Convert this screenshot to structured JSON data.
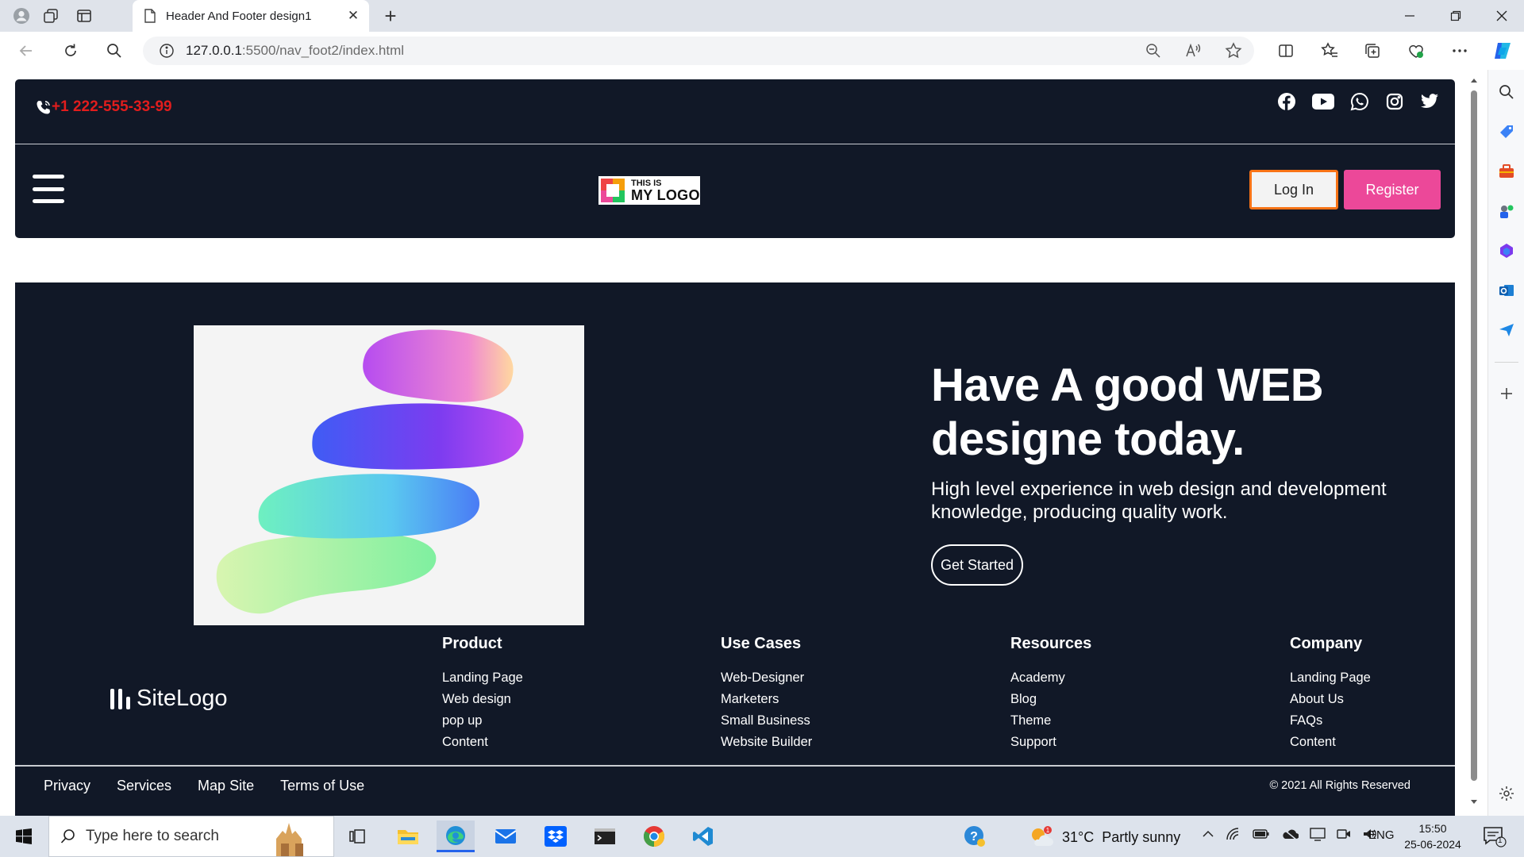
{
  "browser": {
    "tab_title": "Header And Footer design1",
    "url_host": "127.0.0.1",
    "url_path": ":5500/nav_foot2/index.html"
  },
  "header": {
    "phone": "+1 222-555-33-99",
    "logo_line1": "THIS IS",
    "logo_line2": "MY LOGO",
    "login_label": "Log In",
    "register_label": "Register",
    "social_icons": [
      "facebook-icon",
      "youtube-icon",
      "whatsapp-icon",
      "instagram-icon",
      "twitter-icon"
    ]
  },
  "hero": {
    "title": "Have A good WEB designe today.",
    "subtitle": "High level experience in web design and development knowledge, producing quality work.",
    "cta_label": "Get Started"
  },
  "footer": {
    "site_logo_prefix": "Site",
    "site_logo_suffix": "Logo",
    "columns": [
      {
        "heading": "Product",
        "links": [
          "Landing Page",
          "Web design",
          "pop up",
          "Content"
        ]
      },
      {
        "heading": "Use Cases",
        "links": [
          "Web-Designer",
          "Marketers",
          "Small Business",
          "Website Builder"
        ]
      },
      {
        "heading": "Resources",
        "links": [
          "Academy",
          "Blog",
          "Theme",
          "Support"
        ]
      },
      {
        "heading": "Company",
        "links": [
          "Landing Page",
          "About Us",
          "FAQs",
          "Content"
        ]
      }
    ],
    "bottom_links": [
      "Privacy",
      "Services",
      "Map Site",
      "Terms of Use"
    ],
    "copyright": "© 2021 All Rights Reserved"
  },
  "taskbar": {
    "search_placeholder": "Type here to search",
    "weather_temp": "31°C",
    "weather_desc": "Partly sunny",
    "language": "ENG",
    "time": "15:50",
    "date": "25-06-2024",
    "notification_count": "1"
  },
  "colors": {
    "page_dark": "#111827",
    "phone_red": "#e11d1d",
    "register_pink": "#ec4899",
    "login_border": "#f97316"
  }
}
